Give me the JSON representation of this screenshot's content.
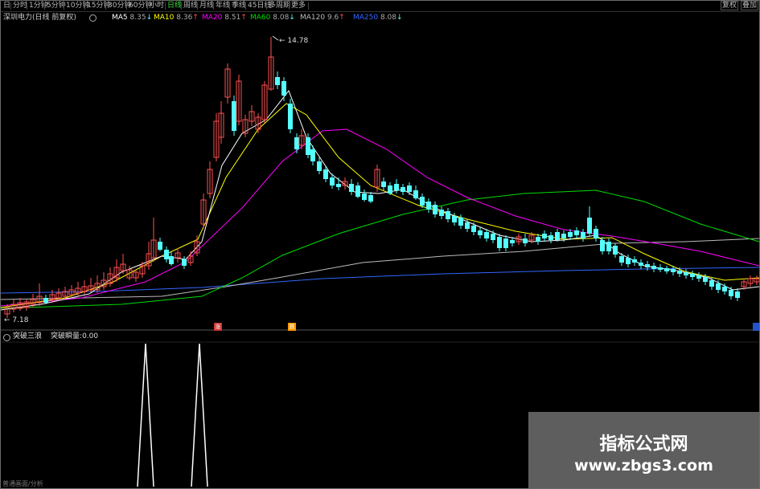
{
  "toolbar": {
    "items": [
      "日",
      "分时",
      "1分钟",
      "5分钟",
      "10分钟",
      "15分钟",
      "30分钟",
      "60分钟",
      "小时",
      "日线",
      "周线",
      "月线",
      "年线",
      "季线",
      "45日线",
      "多周期",
      "更多"
    ],
    "active_index": 9,
    "right_items": [
      "复权",
      "叠加"
    ]
  },
  "legend": {
    "title": "深圳电力(日线 前复权)",
    "ma": [
      {
        "label": "MA5",
        "value": "8.35",
        "arrow": "↓",
        "color": "#ffffff"
      },
      {
        "label": "MA10",
        "value": "8.36",
        "arrow": "↑",
        "color": "#ffff00"
      },
      {
        "label": "MA20",
        "value": "8.51",
        "arrow": "↑",
        "color": "#ff00ff"
      },
      {
        "label": "MA60",
        "value": "8.08",
        "arrow": "↓",
        "color": "#00dd00"
      },
      {
        "label": "MA120",
        "value": "9.6",
        "arrow": "↑",
        "color": "#bbbbbb"
      },
      {
        "label": "MA250",
        "value": "8.08",
        "arrow": "↓",
        "color": "#3366ff"
      }
    ]
  },
  "price_labels": {
    "high": "14.78",
    "low": "7.18"
  },
  "badges": [
    {
      "text": "涨",
      "color": "#cc3333"
    },
    {
      "text": "跌",
      "color": "#ff9900"
    },
    {
      "text": "",
      "color": "#2255cc"
    }
  ],
  "indicator": {
    "name": "突破三浪",
    "output_label": "突破瞬量",
    "output_value": "0.00"
  },
  "bottom_label": "普通画面/分析",
  "watermark": {
    "title": "指标公式网",
    "url": "www.zbgs3.com"
  },
  "colors": {
    "up": "#ff5050",
    "down": "#54ffff",
    "ma5": "#ffffff",
    "ma10": "#ffff00",
    "ma20": "#ff00ff",
    "ma60": "#00dd00",
    "ma120": "#bbbbbb",
    "ma250": "#3366ff"
  }
}
